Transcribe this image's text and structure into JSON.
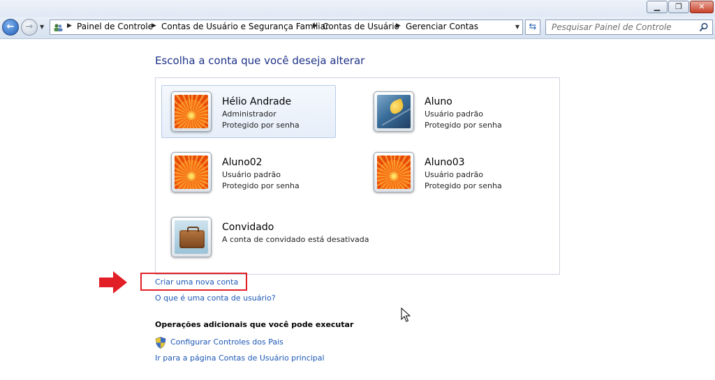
{
  "window": {
    "min_icon": "minimize-icon",
    "max_icon": "maximize-icon",
    "close_icon": "close-icon"
  },
  "navigation": {
    "back_icon": "back-arrow-icon",
    "forward_icon": "forward-arrow-icon",
    "recent_icon": "chevron-down-icon",
    "address_icon": "control-panel-users-icon",
    "breadcrumb": [
      "Painel de Controle",
      "Contas de Usuário e Segurança Familiar",
      "Contas de Usuário",
      "Gerenciar Contas"
    ],
    "refresh_icon": "refresh-icon",
    "search_placeholder": "Pesquisar Painel de Controle",
    "search_icon": "search-icon"
  },
  "main": {
    "heading": "Escolha a conta que você deseja alterar",
    "accounts": [
      {
        "name": "Hélio Andrade",
        "type": "Administrador",
        "status": "Protegido por senha",
        "picture": "orange-flower",
        "selected": true
      },
      {
        "name": "Aluno",
        "type": "Usuário padrão",
        "status": "Protegido por senha",
        "picture": "yellow-leaf",
        "selected": false
      },
      {
        "name": "Aluno02",
        "type": "Usuário padrão",
        "status": "Protegido por senha",
        "picture": "orange-flower",
        "selected": false
      },
      {
        "name": "Aluno03",
        "type": "Usuário padrão",
        "status": "Protegido por senha",
        "picture": "orange-flower",
        "selected": false
      },
      {
        "name": "Convidado",
        "type": "A conta de convidado está desativada",
        "picture": "suitcase",
        "selected": false
      }
    ],
    "links": {
      "create_account": "Criar uma nova conta",
      "what_is_account": "O que é uma conta de usuário?"
    },
    "additional": {
      "heading": "Operações adicionais que você pode executar",
      "parental_controls": "Configurar Controles dos Pais",
      "parental_icon": "uac-shield-icon",
      "main_page": "Ir para a página Contas de Usuário principal"
    }
  },
  "annotations": {
    "arrow_icon": "red-arrow-icon",
    "highlight_color": "#e21f26"
  },
  "colors": {
    "heading": "#1e3287",
    "link": "#1b57b5",
    "selection": "#e6eef9"
  }
}
